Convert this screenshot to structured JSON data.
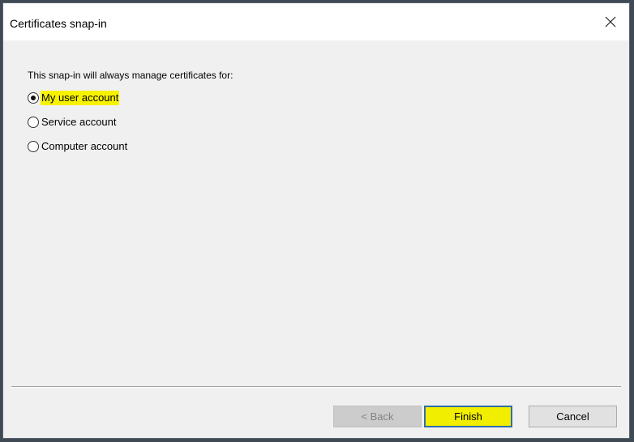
{
  "window": {
    "title": "Certificates snap-in",
    "close_glyph": "✕",
    "close_icon": "close-icon"
  },
  "content": {
    "intro": "This snap-in will always manage certificates for:",
    "options": [
      {
        "label": "My user account",
        "selected": true,
        "highlighted": true
      },
      {
        "label": "Service account",
        "selected": false,
        "highlighted": false
      },
      {
        "label": "Computer account",
        "selected": false,
        "highlighted": false
      }
    ]
  },
  "footer": {
    "back_label": "< Back",
    "back_enabled": false,
    "finish_label": "Finish",
    "cancel_label": "Cancel"
  },
  "colors": {
    "highlight": "#f7f200",
    "dialog_background": "#f0f0f0",
    "focus_border": "#2f6ea8"
  }
}
